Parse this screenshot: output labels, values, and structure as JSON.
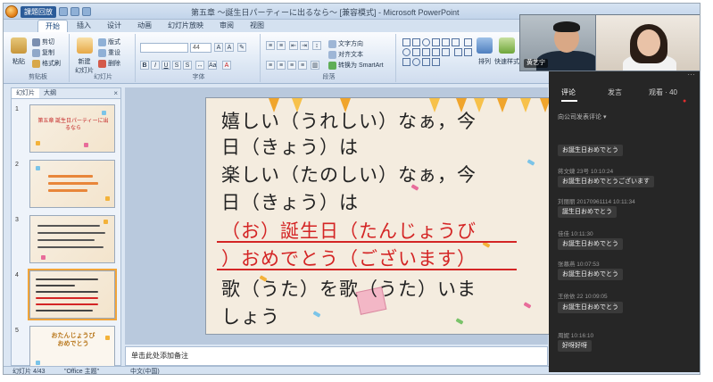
{
  "window": {
    "record_tab": "課題回放",
    "title": "第五章 ～誕生日パーティーに出るなら～ [兼容模式] - Microsoft PowerPoint"
  },
  "ribbon": {
    "tabs": [
      "开始",
      "插入",
      "设计",
      "动画",
      "幻灯片放映",
      "审阅",
      "视图"
    ],
    "active_tab": "开始",
    "clipboard": {
      "paste": "粘贴",
      "cut": "剪切",
      "copy": "复制",
      "format_painter": "格式刷",
      "label": "剪贴板"
    },
    "slides": {
      "new_slide": "新建\n幻灯片",
      "layout": "版式",
      "reset": "重设",
      "delete": "删除",
      "label": "幻灯片"
    },
    "font": {
      "font_name": "",
      "font_size": "44",
      "label": "字体"
    },
    "paragraph": {
      "text_direction": "文字方向",
      "align_text": "对齐文本",
      "smartart": "转换为 SmartArt",
      "label": "段落"
    },
    "drawing": {
      "arrange": "排列",
      "quick_styles": "快速样式"
    }
  },
  "left_panel": {
    "tabs": [
      "幻灯片",
      "大纲"
    ],
    "close": "×",
    "thumbnails": [
      {
        "num": "1",
        "text": "第五章 誕生日パーティーに出るなら"
      },
      {
        "num": "2",
        "text": ""
      },
      {
        "num": "3",
        "text": ""
      },
      {
        "num": "4",
        "text": ""
      },
      {
        "num": "5",
        "text": "おたんじょうび おめでとう"
      }
    ]
  },
  "slide": {
    "lines": [
      "嬉しい（うれしい）なぁ，今",
      "日（きょう）は",
      "楽しい（たのしい）なぁ，今",
      "日（きょう）は",
      "（お）誕生日（たんじょうび",
      "）おめでとう（ございます）",
      "歌（うた）を歌（うた）いま",
      "しょう"
    ]
  },
  "notes": {
    "placeholder": "单击此处添加备注"
  },
  "statusbar": {
    "slide_counter": "幻灯片 4/43",
    "theme": "\"Office 主题\"",
    "language": "中文(中国)"
  },
  "video": {
    "presenter_name": "黄艺宁"
  },
  "comments": {
    "tabs": [
      "评论",
      "发言",
      "观看 · 40"
    ],
    "filter": "向公司发表评论 ▾",
    "messages": [
      {
        "meta": "",
        "text": "お誕生日おめでとう"
      },
      {
        "meta": "蒋文婕 23号  10:10:24",
        "text": "お誕生日おめでとうございます"
      },
      {
        "meta": "刘丽丽 20170961114  10:11:34",
        "text": "誕生日おめでとう"
      },
      {
        "meta": "佳佳  10:11:30",
        "text": "お誕生日おめでとう"
      },
      {
        "meta": "张慕燕  10:07:53",
        "text": "お誕生日おめでとう"
      },
      {
        "meta": "王依依 22  10:09:05",
        "text": "お誕生日おめでとう"
      },
      {
        "meta": "周妮  10:16:10",
        "text": "好呀好呀"
      }
    ]
  },
  "colors": {
    "accent": "#2b5b98",
    "slide_red": "#d42525",
    "panel_bg": "#262626"
  }
}
